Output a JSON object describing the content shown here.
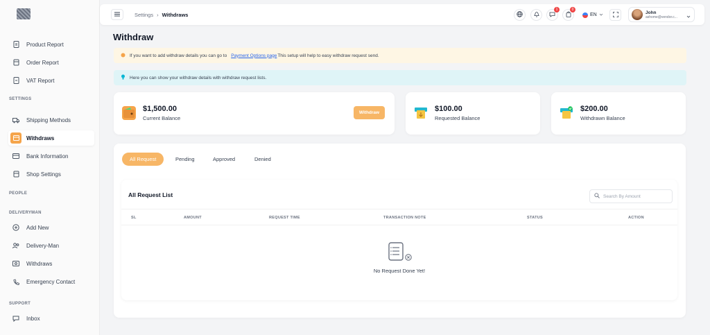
{
  "sidebar": {
    "items_reports": [
      {
        "label": "Product Report",
        "icon": "doc-icon"
      },
      {
        "label": "Order Report",
        "icon": "box-icon"
      },
      {
        "label": "VAT Report",
        "icon": "doc-icon"
      }
    ],
    "section_settings": "SETTINGS",
    "items_settings": [
      {
        "label": "Shipping Methods",
        "icon": "truck-icon"
      },
      {
        "label": "Withdraws",
        "icon": "wallet-icon"
      },
      {
        "label": "Bank Information",
        "icon": "card-icon"
      },
      {
        "label": "Shop Settings",
        "icon": "shop-icon"
      }
    ],
    "section_people": "PEOPLE",
    "section_deliveryman": "DELIVERYMAN",
    "items_delivery": [
      {
        "label": "Add New",
        "icon": "plus-circle-icon"
      },
      {
        "label": "Delivery-Man",
        "icon": "users-icon"
      },
      {
        "label": "Withdraws",
        "icon": "money-icon"
      },
      {
        "label": "Emergency Contact",
        "icon": "phone-icon"
      }
    ],
    "section_support": "SUPPORT",
    "items_support": [
      {
        "label": "Inbox",
        "icon": "chat-icon"
      }
    ]
  },
  "header": {
    "breadcrumb_parent": "Settings",
    "breadcrumb_sep": "›",
    "breadcrumb_current": "Withdraws",
    "messages_badge": "1",
    "cart_badge": "0",
    "language": "EN",
    "user_name": "John",
    "user_email": "ashome@vendor.c..."
  },
  "page": {
    "title": "Withdraw",
    "alert_warn_before": "If you want to add withdraw details you can go to",
    "alert_warn_link": "Payment Options page",
    "alert_warn_after": "This setup will help to easy withdraw request send.",
    "alert_info": "Here you can show your withdraw details with withdraw request lists."
  },
  "balances": {
    "current_amount": "$1,500.00",
    "current_label": "Current Balance",
    "withdraw_button": "Withdraw",
    "requested_amount": "$100.00",
    "requested_label": "Requested Balance",
    "withdrawn_amount": "$200.00",
    "withdrawn_label": "Withdrawn Balance"
  },
  "tabs": [
    "All Request",
    "Pending",
    "Approved",
    "Denied"
  ],
  "list": {
    "title": "All Request List",
    "search_placeholder": "Search By Amount",
    "columns": [
      "SL",
      "AMOUNT",
      "REQUEST TIME",
      "TRANSACTION NOTE",
      "STATUS",
      "ACTION"
    ],
    "empty_text": "No Request Done Yet!"
  },
  "colors": {
    "accent": "#f7b666",
    "warn_bg": "#fef6e4",
    "info_bg": "#dff4f7"
  }
}
